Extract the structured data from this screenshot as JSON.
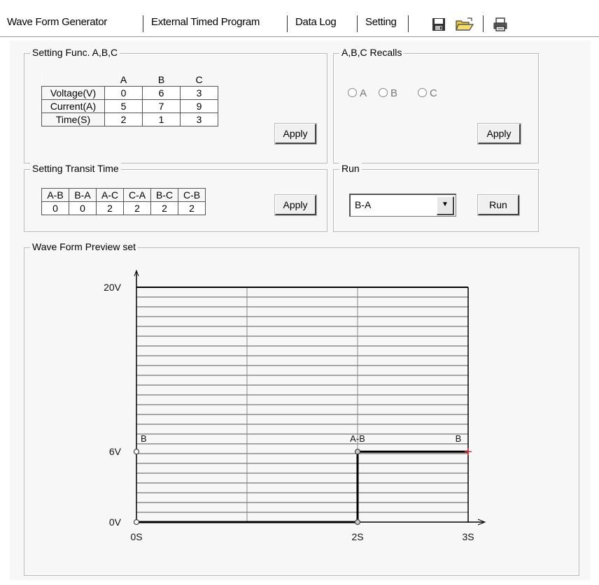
{
  "tabs": [
    {
      "label": "Wave Form Generator"
    },
    {
      "label": "External Timed Program"
    },
    {
      "label": "Data Log"
    },
    {
      "label": "Setting"
    }
  ],
  "toolbar": {
    "icons": [
      "save-icon",
      "open-folder-icon",
      "print-icon"
    ]
  },
  "func_group": {
    "title": "Setting Func. A,B,C",
    "columns": [
      "A",
      "B",
      "C"
    ],
    "rows": [
      {
        "label": "Voltage(V)",
        "values": [
          "0",
          "6",
          "3"
        ]
      },
      {
        "label": "Current(A)",
        "values": [
          "5",
          "7",
          "9"
        ]
      },
      {
        "label": "Time(S)",
        "values": [
          "2",
          "1",
          "3"
        ]
      }
    ],
    "apply_label": "Apply"
  },
  "recall_group": {
    "title": "A,B,C Recalls",
    "options": [
      "A",
      "B",
      "C"
    ],
    "apply_label": "Apply"
  },
  "transit_group": {
    "title": "Setting Transit Time",
    "columns": [
      "A-B",
      "B-A",
      "A-C",
      "C-A",
      "B-C",
      "C-B"
    ],
    "values": [
      "0",
      "0",
      "2",
      "2",
      "2",
      "2"
    ],
    "apply_label": "Apply"
  },
  "run_group": {
    "title": "Run",
    "selected": "B-A",
    "run_label": "Run"
  },
  "preview_group": {
    "title": "Wave Form Preview set"
  },
  "chart_data": {
    "type": "line",
    "y_tick_labels": [
      "20V",
      "6V",
      "0V"
    ],
    "x_tick_labels": [
      "0S",
      "2S",
      "3S"
    ],
    "point_labels": [
      {
        "text": "B",
        "x": 0,
        "y": 6
      },
      {
        "text": "A-B",
        "x": 2,
        "y": 6
      },
      {
        "text": "B",
        "x": 3,
        "y": 6
      }
    ],
    "ylim": [
      0,
      20
    ],
    "xlim": [
      0,
      3
    ],
    "grid": true,
    "series": [
      {
        "x": [
          0,
          2,
          2,
          3
        ],
        "y": [
          0,
          0,
          6,
          6
        ],
        "color": "#000000"
      }
    ],
    "end_marker_color": "#e03030"
  }
}
